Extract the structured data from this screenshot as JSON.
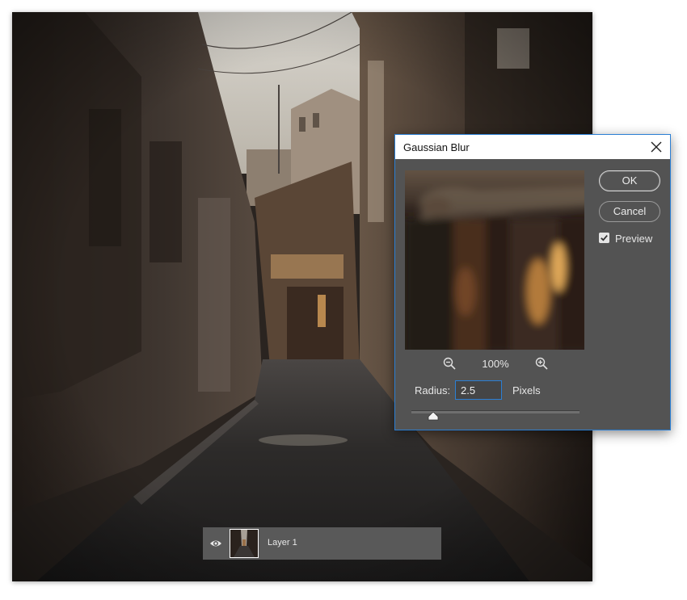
{
  "dialog": {
    "title": "Gaussian Blur",
    "close_icon": "close-icon",
    "ok_label": "OK",
    "cancel_label": "Cancel",
    "preview_label": "Preview",
    "preview_checked": true,
    "zoom_level": "100%",
    "radius_label": "Radius:",
    "radius_value": "2.5",
    "units_label": "Pixels",
    "radius_slider_fraction": 0.13
  },
  "layers": {
    "visibility_icon": "eye-icon",
    "layer_name": "Layer 1"
  },
  "colors": {
    "dialog_bg": "#535353",
    "focus_accent": "#2b7fd4",
    "title_bar": "#ffffff",
    "layer_strip": "#595959"
  }
}
